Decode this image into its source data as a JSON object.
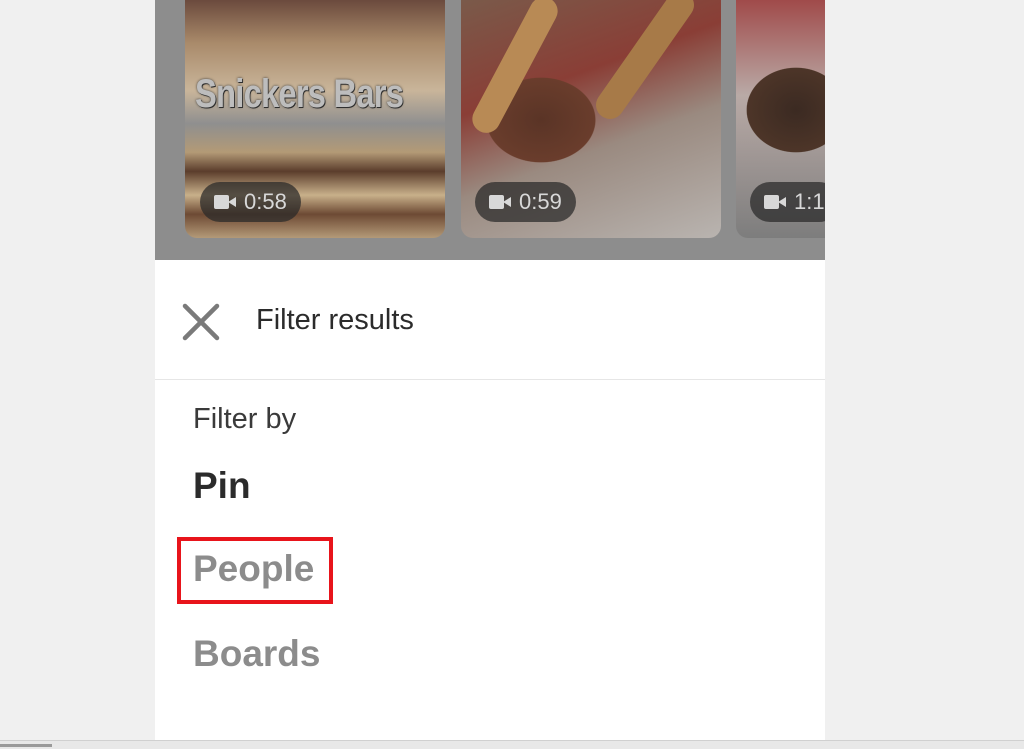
{
  "pins": [
    {
      "overlay_title": "Snickers Bars",
      "duration": "0:58"
    },
    {
      "duration": "0:59"
    },
    {
      "duration": "1:1"
    }
  ],
  "icons": {
    "video": "video-camera-icon",
    "close": "close-icon"
  },
  "filter_sheet": {
    "title": "Filter results",
    "section_label": "Filter by",
    "options": [
      {
        "label": "Pin",
        "state": "selected"
      },
      {
        "label": "People",
        "state": "unselected"
      },
      {
        "label": "Boards",
        "state": "unselected"
      }
    ]
  },
  "colors": {
    "highlight": "#e8141b",
    "selected_text": "#2b2b2b",
    "unselected_text": "#8c8c8c"
  }
}
